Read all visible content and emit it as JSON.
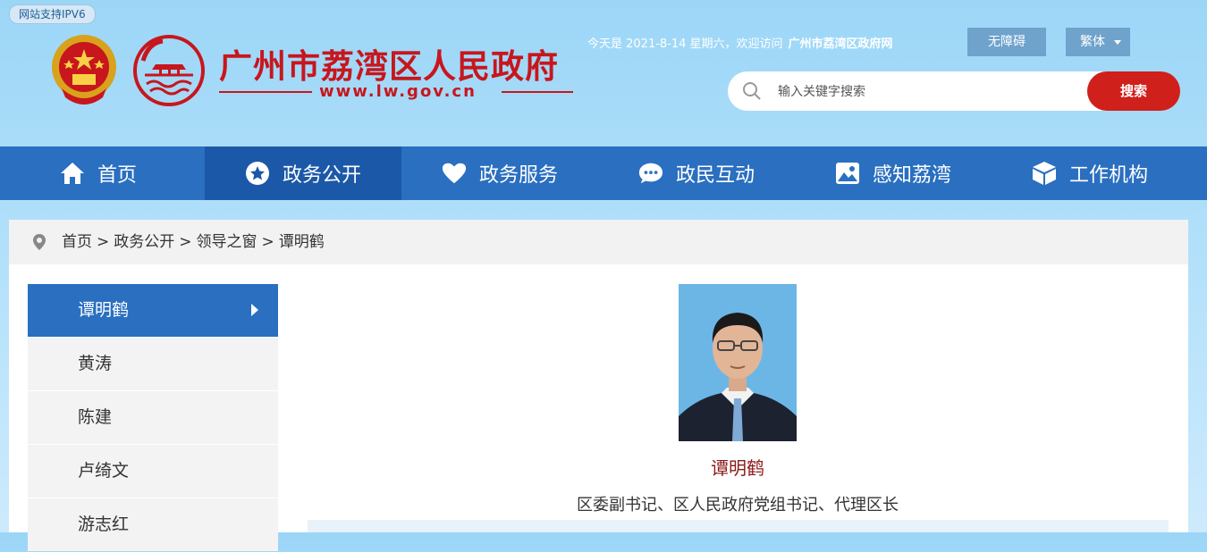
{
  "header": {
    "ipv6_badge": "网站支持IPV6",
    "site_title": "广州市荔湾区人民政府",
    "site_url": "www.lw.gov.cn",
    "welcome_text": "今天是 2021-8-14 星期六，欢迎访问",
    "welcome_site": "广州市荔湾区政府网",
    "accessibility_label": "无障碍",
    "language_label": "繁体",
    "search_placeholder": "输入关键字搜索",
    "search_button": "搜索"
  },
  "nav": {
    "items": [
      {
        "label": "首页",
        "icon": "home-icon"
      },
      {
        "label": "政务公开",
        "icon": "star-icon",
        "active": true
      },
      {
        "label": "政务服务",
        "icon": "heart-icon"
      },
      {
        "label": "政民互动",
        "icon": "chat-icon"
      },
      {
        "label": "感知荔湾",
        "icon": "picture-icon"
      },
      {
        "label": "工作机构",
        "icon": "cube-icon"
      }
    ]
  },
  "breadcrumb": [
    "首页",
    "政务公开",
    "领导之窗",
    "谭明鹤"
  ],
  "breadcrumb_separator": ">",
  "sidebar": {
    "items": [
      {
        "label": "谭明鹤",
        "active": true
      },
      {
        "label": "黄涛"
      },
      {
        "label": "陈建"
      },
      {
        "label": "卢绮文"
      },
      {
        "label": "游志红"
      }
    ]
  },
  "profile": {
    "name": "谭明鹤",
    "title": "区委副书记、区人民政府党组书记、代理区长"
  },
  "colors": {
    "nav_bg": "#2a6fc0",
    "nav_active": "#1c58a8",
    "brand_red": "#c8161d",
    "search_button": "#d0201c"
  }
}
